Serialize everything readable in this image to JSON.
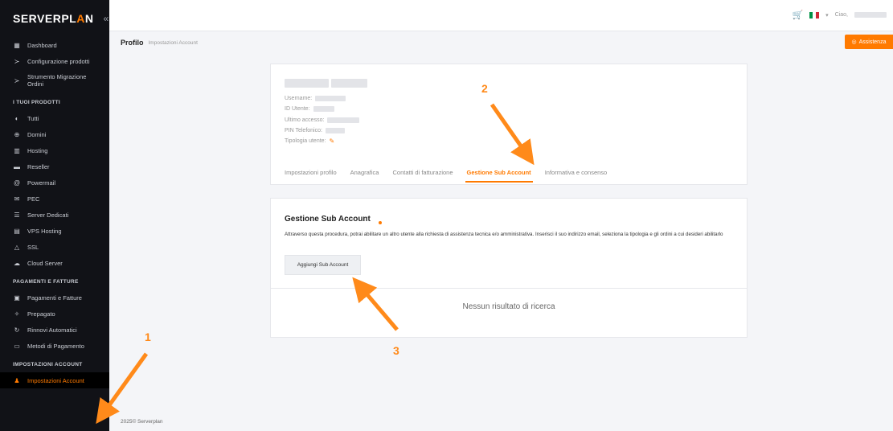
{
  "brand": {
    "logo_left": "SERVERPL",
    "logo_accent": "A",
    "logo_right": "N",
    "collapse": "«",
    "accent": "#ff7a00"
  },
  "topbar": {
    "greeting": "Ciao,",
    "assist_label": "Assistenza"
  },
  "breadcrumb": {
    "title": "Profilo",
    "sub": "Impostazioni Account"
  },
  "sidebar": {
    "items": [
      {
        "icon": "dashboard-icon",
        "glyph": "▦",
        "label": "Dashboard"
      },
      {
        "icon": "config-icon",
        "glyph": "≻",
        "label": "Configurazione prodotti"
      },
      {
        "icon": "migration-icon",
        "glyph": "≻",
        "label": "Strumento Migrazione Ordini"
      }
    ],
    "section_products": "I TUOI PRODOTTI",
    "products": [
      {
        "icon": "all-icon",
        "glyph": "◐",
        "label": "Tutti"
      },
      {
        "icon": "domain-icon",
        "glyph": "⊕",
        "label": "Domini"
      },
      {
        "icon": "hosting-icon",
        "glyph": "▥",
        "label": "Hosting"
      },
      {
        "icon": "reseller-icon",
        "glyph": "▬",
        "label": "Reseller"
      },
      {
        "icon": "email-icon",
        "glyph": "@",
        "label": "Powermail"
      },
      {
        "icon": "pec-icon",
        "glyph": "✉",
        "label": "PEC"
      },
      {
        "icon": "server-icon",
        "glyph": "☰",
        "label": "Server Dedicati"
      },
      {
        "icon": "vps-icon",
        "glyph": "▤",
        "label": "VPS Hosting"
      },
      {
        "icon": "ssl-icon",
        "glyph": "△",
        "label": "SSL"
      },
      {
        "icon": "cloud-icon",
        "glyph": "☁",
        "label": "Cloud Server"
      }
    ],
    "section_payments": "PAGAMENTI E FATTURE",
    "payments": [
      {
        "icon": "invoice-icon",
        "glyph": "▣",
        "label": "Pagamenti e Fatture"
      },
      {
        "icon": "prepaid-icon",
        "glyph": "✧",
        "label": "Prepagato"
      },
      {
        "icon": "renewal-icon",
        "glyph": "↻",
        "label": "Rinnovi Automatici"
      },
      {
        "icon": "card-icon",
        "glyph": "▭",
        "label": "Metodi di Pagamento"
      }
    ],
    "section_settings": "IMPOSTAZIONI ACCOUNT",
    "active_item": {
      "icon": "user-settings-icon",
      "glyph": "♟",
      "label": "Impostazioni Account"
    }
  },
  "profile": {
    "fields": [
      {
        "label": "Username:"
      },
      {
        "label": "ID Utente:"
      },
      {
        "label": "Ultimo accesso:"
      },
      {
        "label": "PIN Telefonico:"
      },
      {
        "label": "Tipologia utente:"
      }
    ],
    "tabs": [
      "Impostazioni profilo",
      "Anagrafica",
      "Contatti di fatturazione",
      "Gestione Sub Account",
      "Informativa e consenso"
    ]
  },
  "subaccount": {
    "title": "Gestione Sub Account",
    "description": "Attraverso questa procedura, potrai abilitare un altro utente alla richiesta di assistenza tecnica e/o amministrativa. Inserisci il suo indirizzo email, seleziona la tipologia e gli ordini a cui desideri abilitarlo",
    "add_button": "Aggiungi Sub Account",
    "empty_text": "Nessun risultato di ricerca"
  },
  "footer": {
    "copyright": "2025© Serverplan"
  },
  "annotations": [
    "1",
    "2",
    "3"
  ]
}
